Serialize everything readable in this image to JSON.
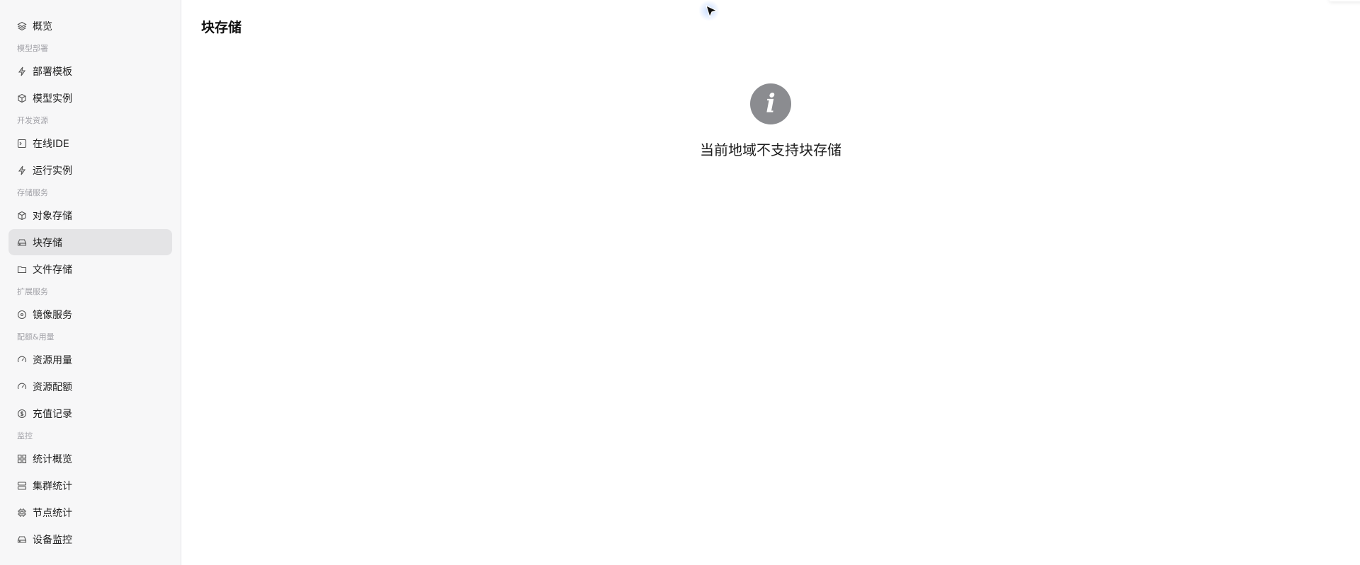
{
  "sidebar": {
    "overview": {
      "label": "概览",
      "icon": "layers-icon"
    },
    "sections": {
      "model_deploy": "模型部署",
      "dev_resources": "开发资源",
      "storage_services": "存储服务",
      "extension_services": "扩展服务",
      "quota_usage": "配额&用量",
      "monitoring": "监控"
    },
    "items": {
      "deploy_template": {
        "label": "部署模板",
        "icon": "bolt-icon"
      },
      "model_instance": {
        "label": "模型实例",
        "icon": "cube-stack-icon"
      },
      "online_ide": {
        "label": "在线IDE",
        "icon": "terminal-icon"
      },
      "run_instance": {
        "label": "运行实例",
        "icon": "bolt-icon"
      },
      "object_storage": {
        "label": "对象存储",
        "icon": "box-icon"
      },
      "block_storage": {
        "label": "块存储",
        "icon": "hard-drive-icon",
        "active": true
      },
      "file_storage": {
        "label": "文件存储",
        "icon": "folder-icon"
      },
      "image_service": {
        "label": "镜像服务",
        "icon": "disc-icon"
      },
      "resource_usage": {
        "label": "资源用量",
        "icon": "gauge-icon"
      },
      "resource_quota": {
        "label": "资源配额",
        "icon": "gauge-icon"
      },
      "recharge_records": {
        "label": "充值记录",
        "icon": "dollar-circle-icon"
      },
      "stats_overview": {
        "label": "统计概览",
        "icon": "grid-icon"
      },
      "cluster_stats": {
        "label": "集群统计",
        "icon": "server-icon"
      },
      "node_stats": {
        "label": "节点统计",
        "icon": "chip-icon"
      },
      "device_monitor": {
        "label": "设备监控",
        "icon": "hard-drive-icon"
      }
    }
  },
  "main": {
    "title": "块存储",
    "empty_message": "当前地域不支持块存储",
    "empty_icon": "info-icon",
    "empty_icon_glyph": "i"
  },
  "colors": {
    "sidebar_bg": "#f7f7f8",
    "active_item_bg": "#e4e4e6",
    "info_icon_bg": "#8b8c90"
  }
}
